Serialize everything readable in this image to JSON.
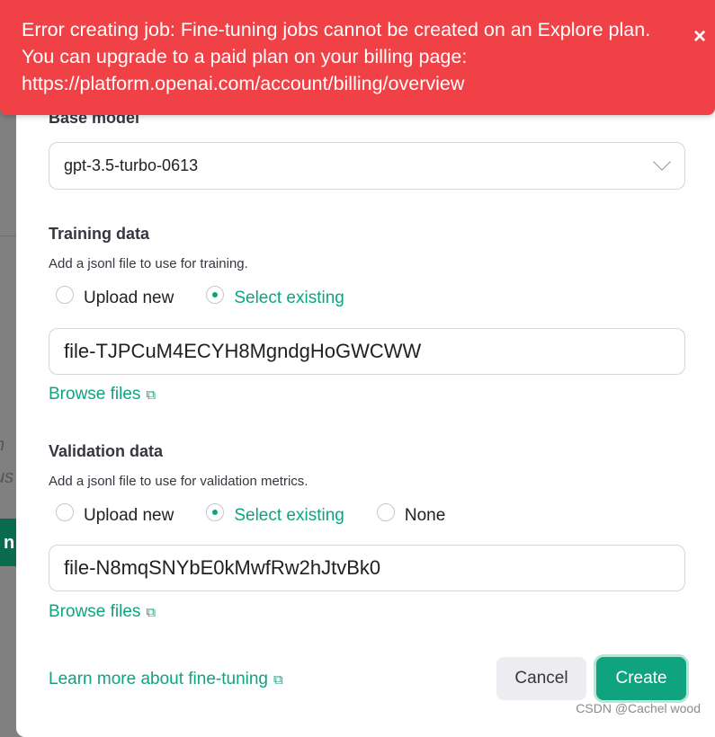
{
  "background": {
    "fragments": [
      "n",
      "us",
      "n"
    ]
  },
  "toast": {
    "message": "Error creating job: Fine-tuning jobs cannot be created on an Explore plan. You can upgrade to a paid plan on your billing page: https://platform.openai.com/account/billing/overview",
    "close": "×",
    "color": "#ef4146"
  },
  "base_model": {
    "label": "Base model",
    "value": "gpt-3.5-turbo-0613"
  },
  "training": {
    "label": "Training data",
    "hint": "Add a jsonl file to use for training.",
    "options": [
      "Upload new",
      "Select existing"
    ],
    "selected": "Select existing",
    "value": "file-TJPCuM4ECYH8MgndgHoGWCWW",
    "browse": "Browse files"
  },
  "validation": {
    "label": "Validation data",
    "hint": "Add a jsonl file to use for validation metrics.",
    "options": [
      "Upload new",
      "Select existing",
      "None"
    ],
    "selected": "Select existing",
    "value": "file-N8mqSNYbE0kMwfRw2hJtvBk0",
    "browse": "Browse files"
  },
  "footer": {
    "learn_more": "Learn more about fine-tuning",
    "cancel": "Cancel",
    "create": "Create"
  },
  "watermark": "CSDN @Cachel wood",
  "accent": "#10a37f"
}
